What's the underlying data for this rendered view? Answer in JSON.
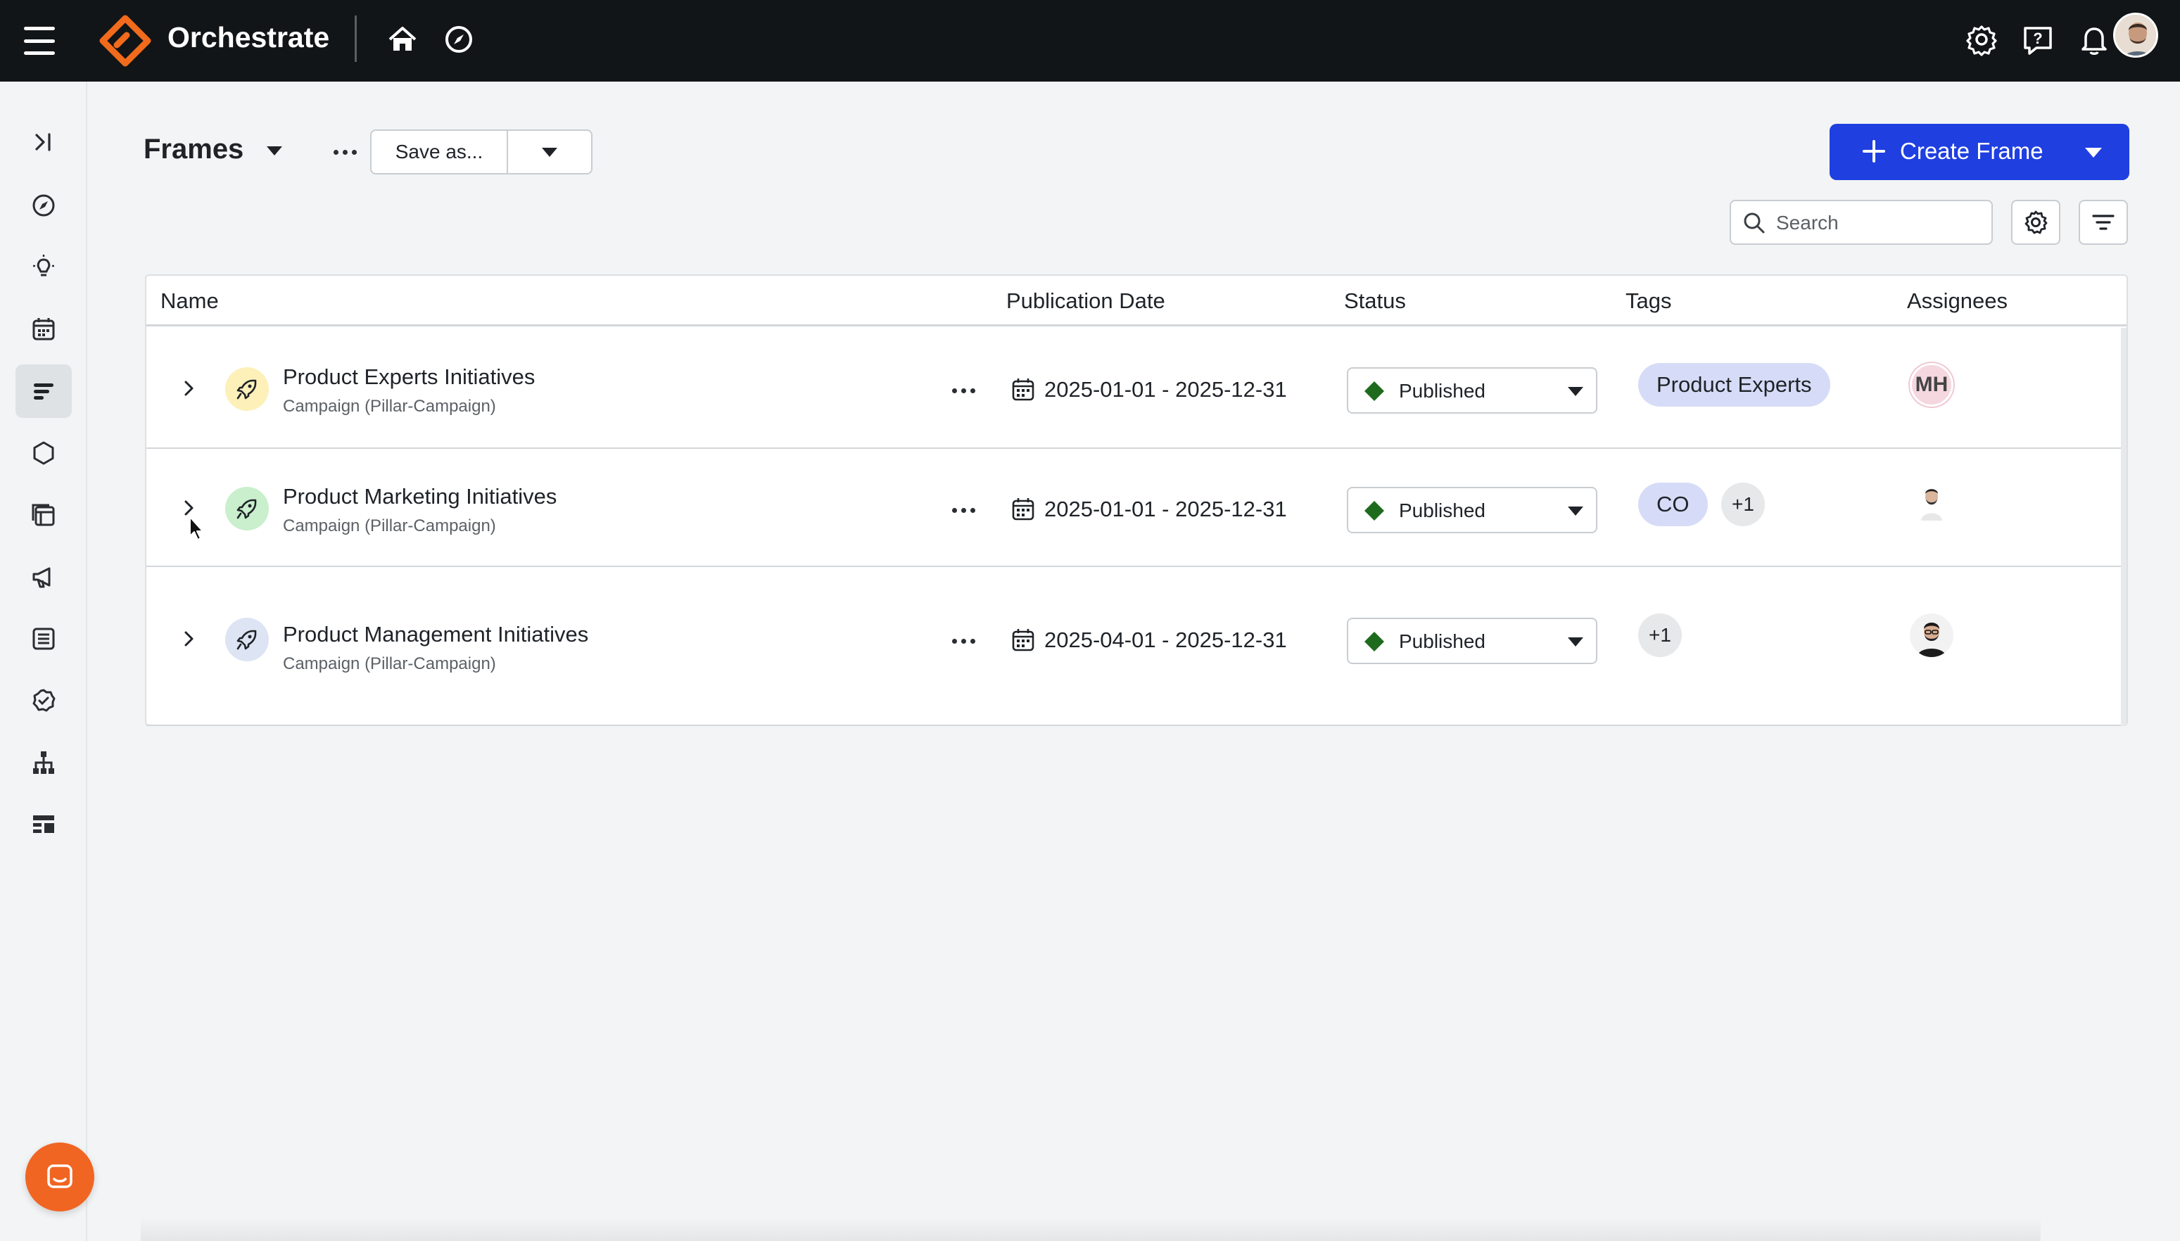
{
  "app": {
    "title": "Orchestrate",
    "brand_color": "#f26b1d",
    "accent_color": "#1f3fe0"
  },
  "topbar": {
    "icons": [
      "menu-icon",
      "home-icon",
      "compass-icon",
      "settings-icon",
      "help-icon",
      "bell-icon",
      "avatar"
    ]
  },
  "sidebar": {
    "items": [
      {
        "name": "collapse",
        "icon": "expand-sidebar-icon"
      },
      {
        "name": "explore",
        "icon": "compass-icon"
      },
      {
        "name": "ideas",
        "icon": "lightbulb-icon"
      },
      {
        "name": "calendar",
        "icon": "calendar-icon"
      },
      {
        "name": "frames",
        "icon": "frames-icon",
        "active": true
      },
      {
        "name": "hexagon",
        "icon": "hexagon-icon"
      },
      {
        "name": "assets",
        "icon": "browser-stack-icon"
      },
      {
        "name": "campaigns",
        "icon": "megaphone-icon"
      },
      {
        "name": "lists",
        "icon": "list-icon"
      },
      {
        "name": "approvals",
        "icon": "check-circle-icon"
      },
      {
        "name": "hierarchy",
        "icon": "hierarchy-icon"
      },
      {
        "name": "layouts",
        "icon": "layout-icon"
      }
    ]
  },
  "header": {
    "title": "Frames",
    "save_as_label": "Save as...",
    "create_label": "Create Frame",
    "search_placeholder": "Search"
  },
  "table": {
    "columns": [
      "Name",
      "Publication Date",
      "Status",
      "Tags",
      "Assignees"
    ],
    "rows": [
      {
        "name": "Product Experts Initiatives",
        "subtitle": "Campaign (Pillar-Campaign)",
        "icon_bg": "#fdf0b8",
        "date": "2025-01-01 - 2025-12-31",
        "status": "Published",
        "tags": [
          "Product Experts"
        ],
        "tag_more": "",
        "assignee": "MH"
      },
      {
        "name": "Product Marketing Initiatives",
        "subtitle": "Campaign (Pillar-Campaign)",
        "icon_bg": "#c9efcc",
        "date": "2025-01-01 - 2025-12-31",
        "status": "Published",
        "tags": [
          "CO"
        ],
        "tag_more": "+1",
        "assignee": ""
      },
      {
        "name": "Product Management Initiatives",
        "subtitle": "Campaign (Pillar-Campaign)",
        "icon_bg": "#dde4f3",
        "date": "2025-04-01 - 2025-12-31",
        "status": "Published",
        "tags": [],
        "tag_more": "+1",
        "assignee": ""
      }
    ],
    "status_color": "#1e6b1e"
  }
}
